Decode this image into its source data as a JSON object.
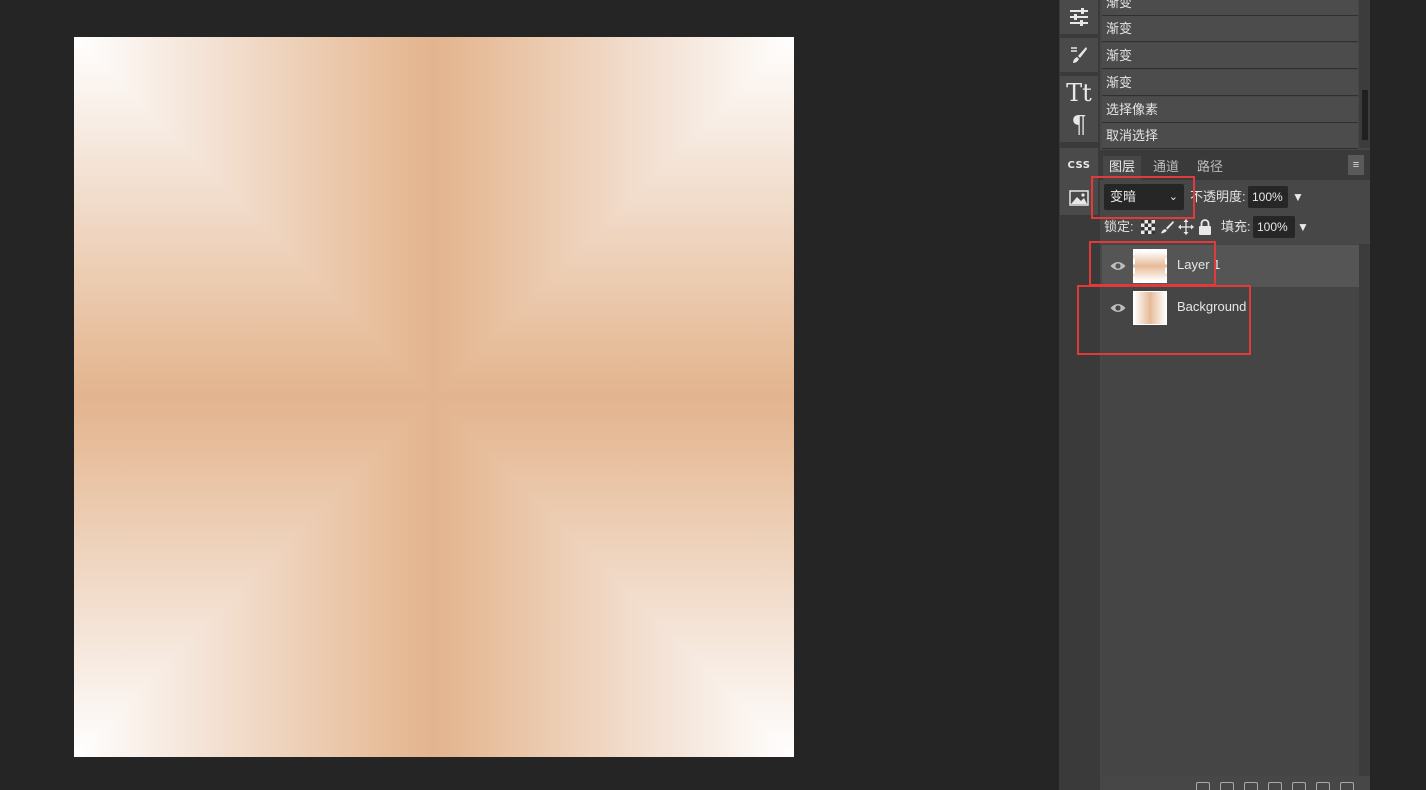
{
  "history": {
    "items": [
      {
        "label": "渐变"
      },
      {
        "label": "渐变"
      },
      {
        "label": "渐变"
      },
      {
        "label": "渐变"
      },
      {
        "label": "选择像素"
      },
      {
        "label": "取消选择"
      }
    ]
  },
  "tools": [
    {
      "icon": "adjustments-icon"
    },
    {
      "icon": "brush-settings-icon"
    },
    {
      "icon": "character-icon",
      "glyph": "Tt"
    },
    {
      "icon": "paragraph-icon",
      "glyph": "¶"
    },
    {
      "icon": "css-icon",
      "glyph": "CSS"
    },
    {
      "icon": "image-icon"
    }
  ],
  "tabs": [
    {
      "label": "图层",
      "active": true
    },
    {
      "label": "通道",
      "active": false
    },
    {
      "label": "路径",
      "active": false
    }
  ],
  "panel_menu_glyph": "≡",
  "blend": {
    "mode": "变暗",
    "chevron": "⌄"
  },
  "opacity": {
    "label": "不透明度:",
    "value": "100%",
    "arrow": "▼"
  },
  "lock": {
    "label": "锁定:"
  },
  "fill": {
    "label": "填充:",
    "value": "100%",
    "arrow": "▼"
  },
  "layers": [
    {
      "name": "Layer 1",
      "selected": true,
      "visible": true
    },
    {
      "name": "Background",
      "selected": false,
      "visible": true
    }
  ],
  "colors": {
    "canvas_peach": "#e3b48f",
    "highlight_red": "#e03a3a",
    "panel_gray": "#474747"
  }
}
